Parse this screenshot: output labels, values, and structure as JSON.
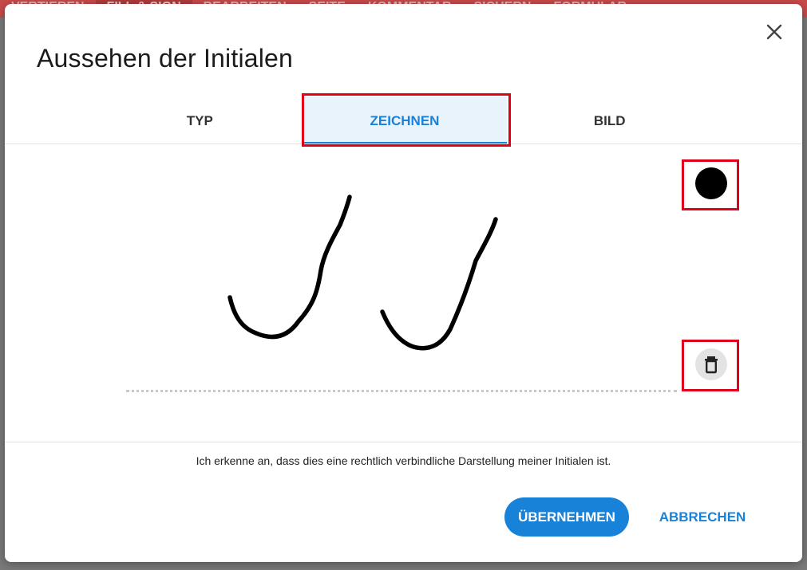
{
  "background_toolbar": {
    "items": [
      "VERTIEREN",
      "FILL & SIGN",
      "BEARBEITEN",
      "SEITE",
      "KOMMENTAR",
      "SICHERN",
      "FORMULAR"
    ]
  },
  "dialog": {
    "title": "Aussehen der Initialen",
    "close_icon": "close-icon",
    "tabs": [
      {
        "label": "TYP",
        "active": false
      },
      {
        "label": "ZEICHNEN",
        "active": true
      },
      {
        "label": "BILD",
        "active": false
      }
    ],
    "draw_area": {
      "ink_color": "#000000",
      "clear_icon": "trash-icon"
    },
    "legal_text": "Ich erkenne an, dass dies eine rechtlich verbindliche Darstellung meiner Initialen ist.",
    "buttons": {
      "apply": "ÜBERNEHMEN",
      "cancel": "ABBRECHEN"
    }
  },
  "colors": {
    "accent": "#1782d8",
    "highlight": "#e0001a"
  }
}
